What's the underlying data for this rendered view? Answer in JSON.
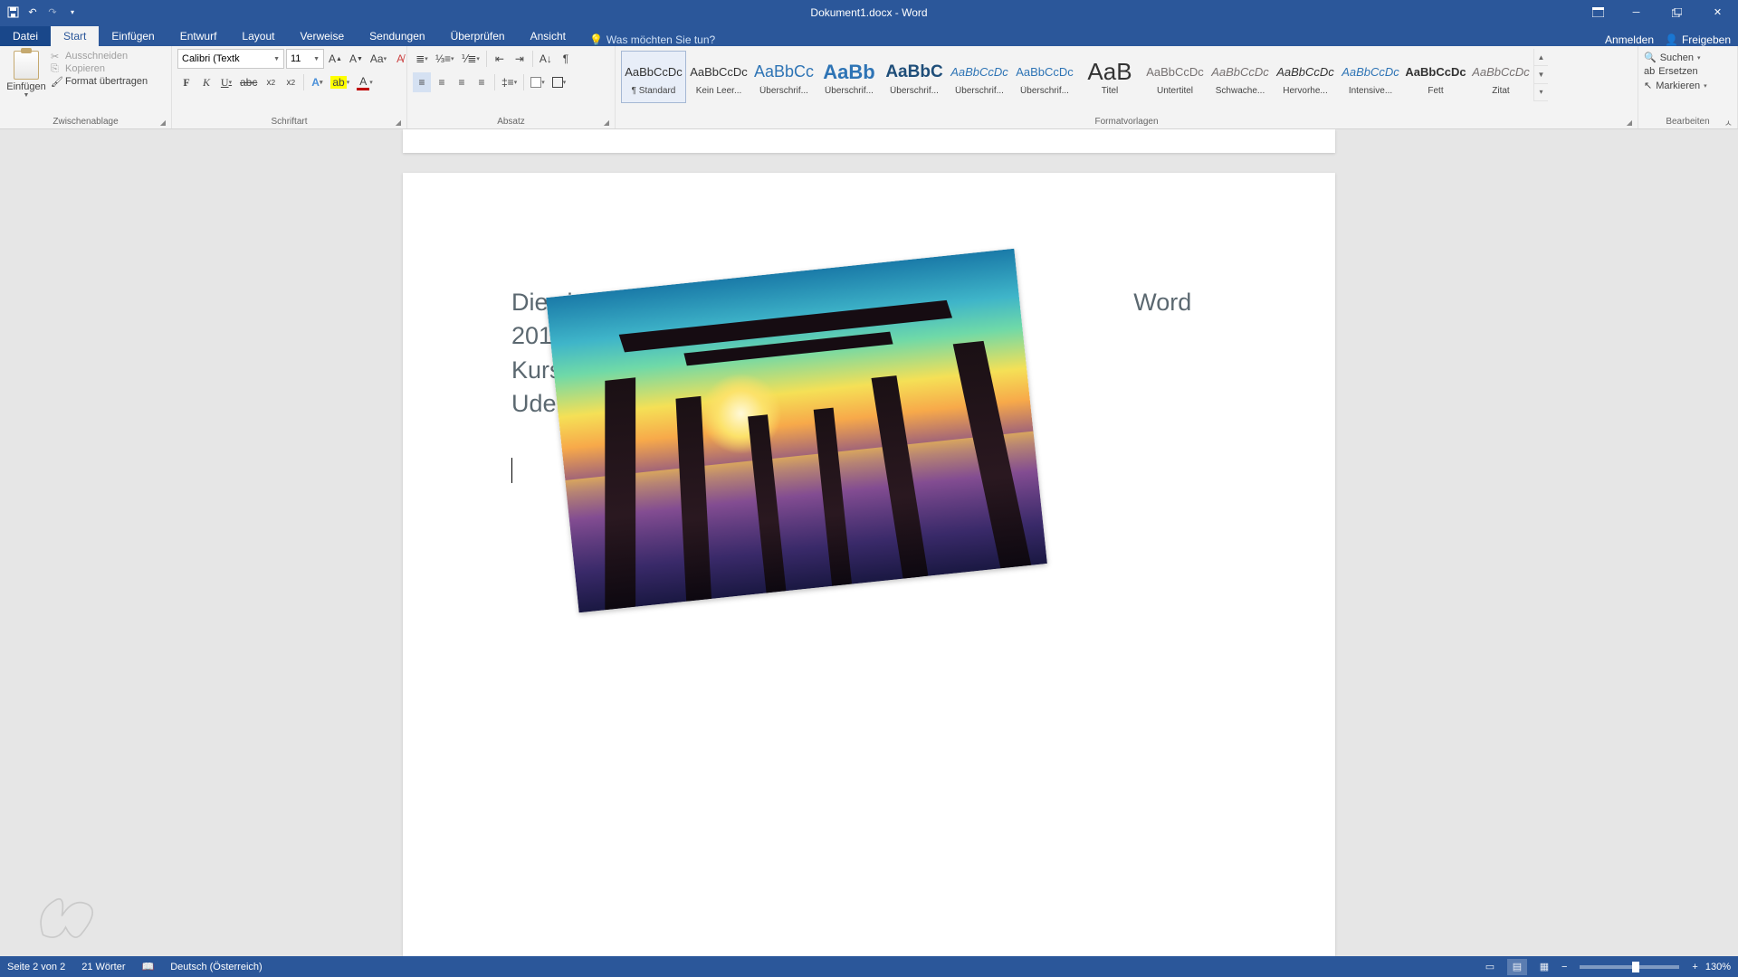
{
  "title": "Dokument1.docx - Word",
  "qat": {
    "save": "💾",
    "undo": "↶",
    "redo": "↷",
    "custom": "▾"
  },
  "tabs": {
    "file": "Datei",
    "items": [
      "Start",
      "Einfügen",
      "Entwurf",
      "Layout",
      "Verweise",
      "Sendungen",
      "Überprüfen",
      "Ansicht"
    ],
    "active": 0
  },
  "tellme": {
    "placeholder": "Was möchten Sie tun?"
  },
  "account": {
    "signin": "Anmelden",
    "share": "Freigeben"
  },
  "clipboard": {
    "paste": "Einfügen",
    "cut": "Ausschneiden",
    "copy": "Kopieren",
    "format": "Format übertragen",
    "label": "Zwischenablage"
  },
  "font": {
    "name": "Calibri (Textk",
    "size": "11",
    "label": "Schriftart"
  },
  "paragraph": {
    "label": "Absatz"
  },
  "styles": {
    "label": "Formatvorlagen",
    "items": [
      {
        "preview": "AaBbCcDc",
        "name": "¶ Standard",
        "style": "font-size:13px;color:#333"
      },
      {
        "preview": "AaBbCcDc",
        "name": "Kein Leer...",
        "style": "font-size:13px;color:#333"
      },
      {
        "preview": "AaBbCc",
        "name": "Überschrif...",
        "style": "font-size:18px;color:#2e74b5"
      },
      {
        "preview": "AaBb",
        "name": "Überschrif...",
        "style": "font-size:22px;color:#2e74b5;font-weight:bold"
      },
      {
        "preview": "AaBbC",
        "name": "Überschrif...",
        "style": "font-size:19px;color:#1f4e79;font-weight:bold"
      },
      {
        "preview": "AaBbCcDc",
        "name": "Überschrif...",
        "style": "font-size:13px;color:#2e74b5;font-style:italic"
      },
      {
        "preview": "AaBbCcDc",
        "name": "Überschrif...",
        "style": "font-size:13px;color:#2e74b5"
      },
      {
        "preview": "AaB",
        "name": "Titel",
        "style": "font-size:26px;color:#333"
      },
      {
        "preview": "AaBbCcDc",
        "name": "Untertitel",
        "style": "font-size:13px;color:#767171"
      },
      {
        "preview": "AaBbCcDc",
        "name": "Schwache...",
        "style": "font-size:13px;color:#767171;font-style:italic"
      },
      {
        "preview": "AaBbCcDc",
        "name": "Hervorhe...",
        "style": "font-size:13px;color:#333;font-style:italic"
      },
      {
        "preview": "AaBbCcDc",
        "name": "Intensive...",
        "style": "font-size:13px;color:#2e74b5;font-style:italic"
      },
      {
        "preview": "AaBbCcDc",
        "name": "Fett",
        "style": "font-size:13px;color:#333;font-weight:bold"
      },
      {
        "preview": "AaBbCcDc",
        "name": "Zitat",
        "style": "font-size:13px;color:#767171;font-style:italic"
      }
    ]
  },
  "editing": {
    "find": "Suchen",
    "replace": "Ersetzen",
    "select": "Markieren",
    "label": "Bearbeiten"
  },
  "document": {
    "text_left_1": "Dies ist der",
    "text_left_2": "Kurs auf",
    "text_right_1": "Word 2016",
    "text_right_2": "Udemy"
  },
  "status": {
    "page": "Seite 2 von 2",
    "words": "21 Wörter",
    "lang": "Deutsch (Österreich)",
    "zoom": "130%"
  }
}
